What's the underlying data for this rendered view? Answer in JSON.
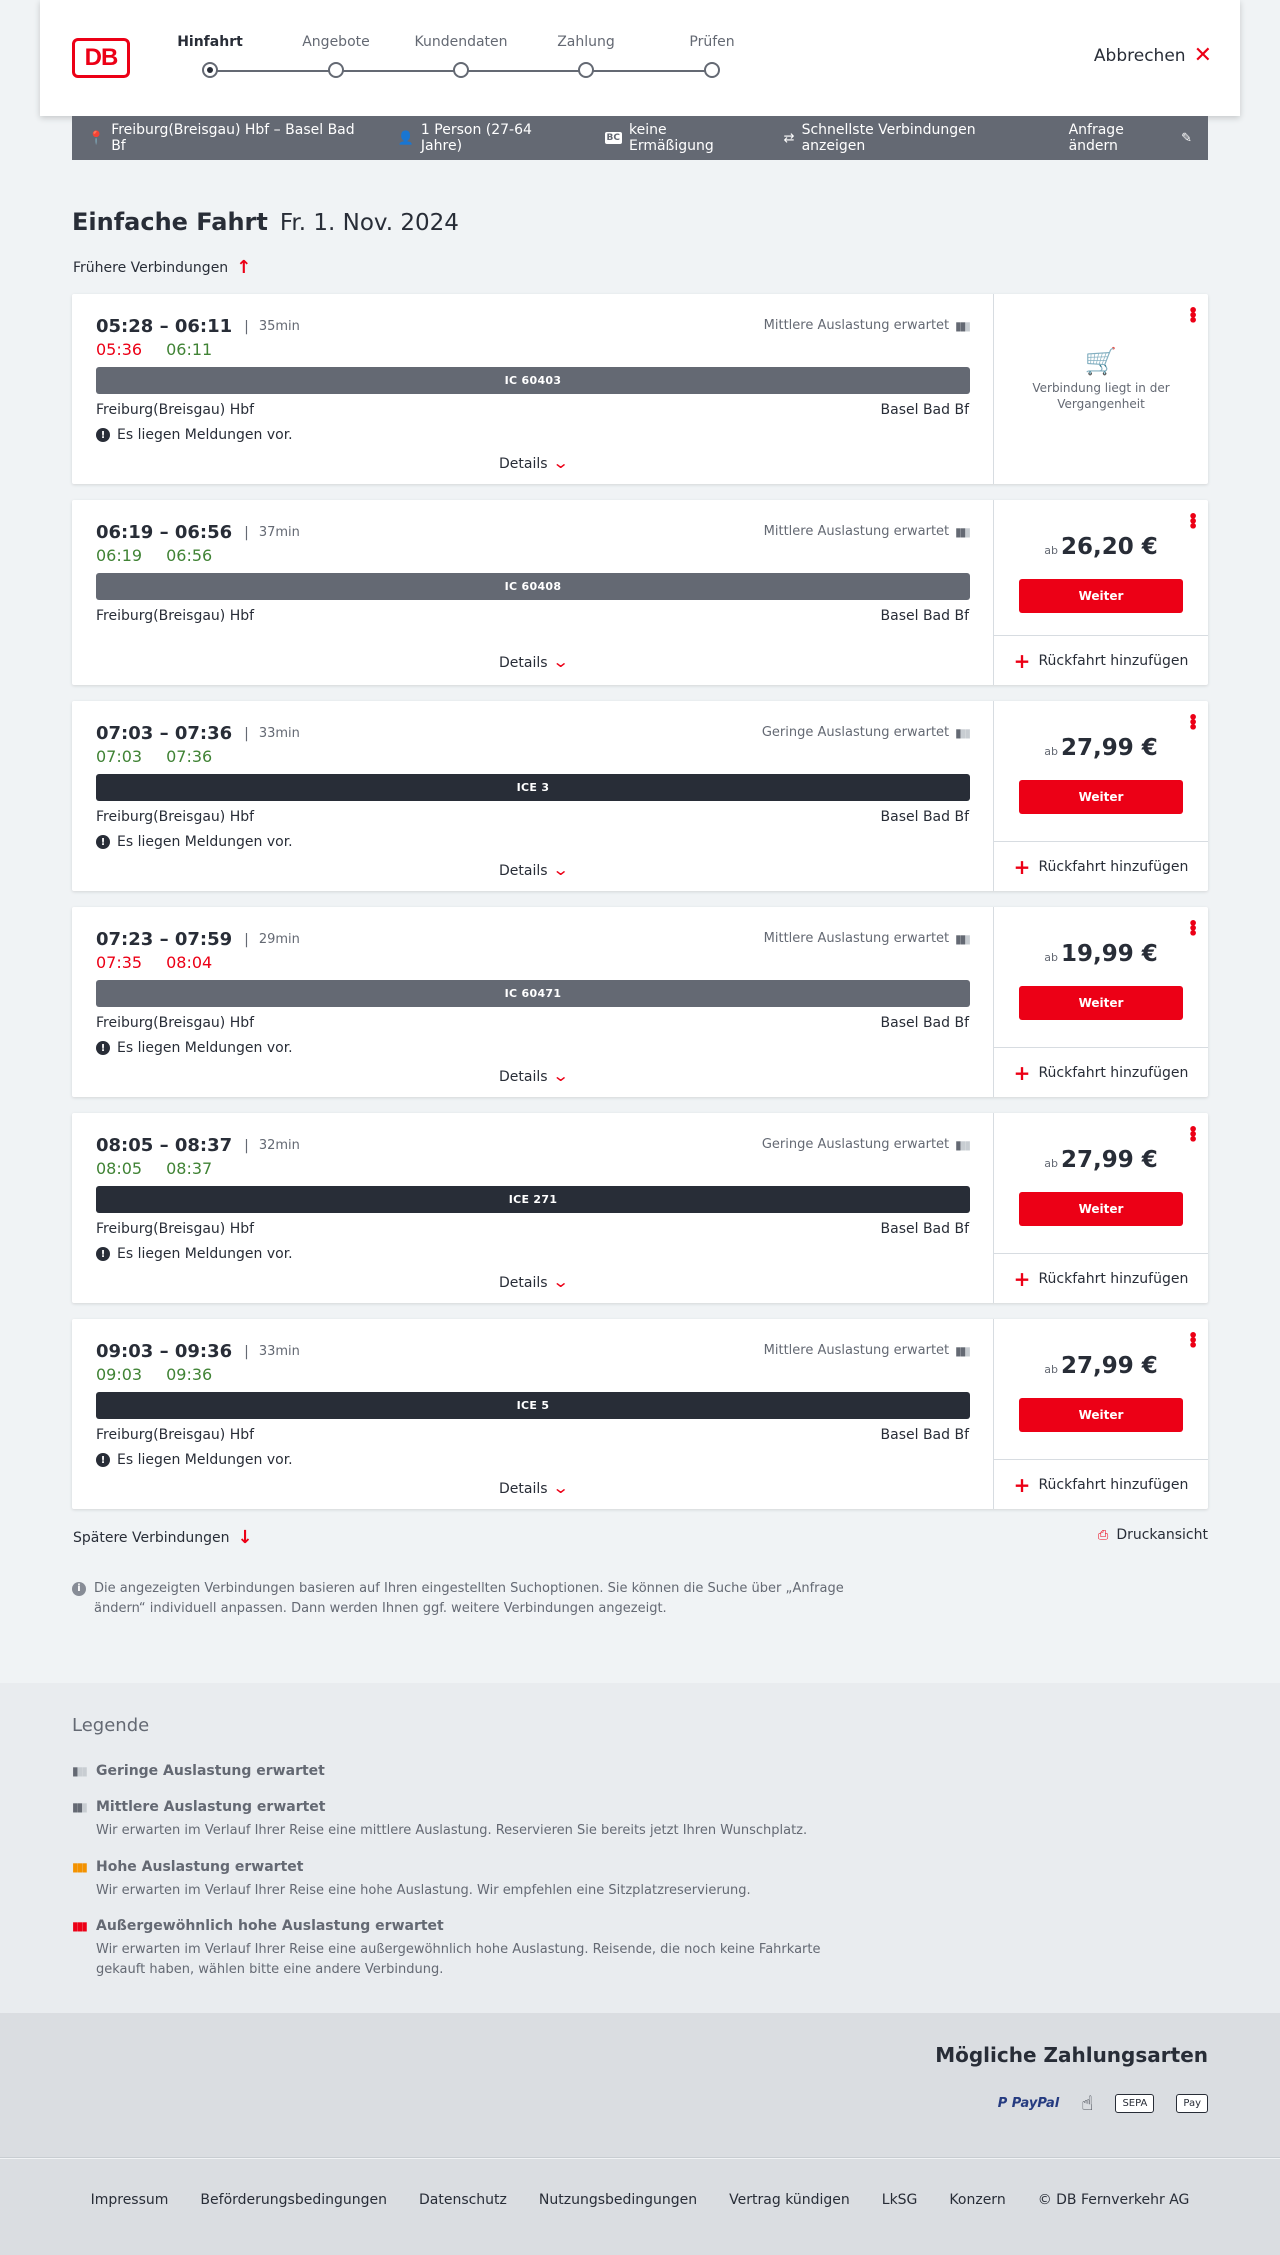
{
  "header": {
    "logo_text": "DB",
    "steps": [
      {
        "label": "Hinfahrt",
        "active": true
      },
      {
        "label": "Angebote",
        "active": false
      },
      {
        "label": "Kundendaten",
        "active": false
      },
      {
        "label": "Zahlung",
        "active": false
      },
      {
        "label": "Prüfen",
        "active": false
      }
    ],
    "cancel_label": "Abbrechen"
  },
  "request": {
    "route": "Freiburg(Breisgau) Hbf – Basel Bad Bf",
    "persons": "1 Person (27-64 Jahre)",
    "bc_badge": "BC",
    "discount": "keine Ermäßigung",
    "fastest": "Schnellste Verbindungen anzeigen",
    "change": "Anfrage ändern"
  },
  "page": {
    "title": "Einfache Fahrt",
    "date": "Fr. 1. Nov. 2024",
    "earlier": "Frühere Verbindungen",
    "later": "Spätere Verbindungen",
    "print": "Druckansicht",
    "info": "Die angezeigten Verbindungen basieren auf Ihren eingestellten Suchoptionen. Sie können die Suche über „Anfrage ändern“ individuell anpassen. Dann werden Ihnen ggf. weitere Verbindungen angezeigt."
  },
  "common": {
    "from": "Freiburg(Breisgau) Hbf",
    "to": "Basel Bad Bf",
    "details": "Details",
    "message": "Es liegen Meldungen vor.",
    "weiter": "Weiter",
    "ab": "ab",
    "rueckfahrt": "Rückfahrt hinzufügen",
    "past_text": "Verbindung liegt in der Vergangenheit"
  },
  "connections": [
    {
      "times": "05:28 – 06:11",
      "duration": "35min",
      "rt_dep": "05:36",
      "rt_arr": "06:11",
      "rt_dep_status": "late",
      "rt_arr_status": "ok",
      "occupancy": "Mittlere Auslastung erwartet",
      "occ_level": 2,
      "train": "IC 60403",
      "train_type": "ic",
      "message": true,
      "past": true,
      "price": ""
    },
    {
      "times": "06:19 – 06:56",
      "duration": "37min",
      "rt_dep": "06:19",
      "rt_arr": "06:56",
      "rt_dep_status": "ok",
      "rt_arr_status": "ok",
      "occupancy": "Mittlere Auslastung erwartet",
      "occ_level": 2,
      "train": "IC 60408",
      "train_type": "ic",
      "message": false,
      "past": false,
      "price": "26,20 €"
    },
    {
      "times": "07:03 – 07:36",
      "duration": "33min",
      "rt_dep": "07:03",
      "rt_arr": "07:36",
      "rt_dep_status": "ok",
      "rt_arr_status": "ok",
      "occupancy": "Geringe Auslastung erwartet",
      "occ_level": 1,
      "train": "ICE 3",
      "train_type": "ice",
      "message": true,
      "past": false,
      "price": "27,99 €"
    },
    {
      "times": "07:23 – 07:59",
      "duration": "29min",
      "rt_dep": "07:35",
      "rt_arr": "08:04",
      "rt_dep_status": "late",
      "rt_arr_status": "late",
      "occupancy": "Mittlere Auslastung erwartet",
      "occ_level": 2,
      "train": "IC 60471",
      "train_type": "ic",
      "message": true,
      "past": false,
      "price": "19,99 €"
    },
    {
      "times": "08:05 – 08:37",
      "duration": "32min",
      "rt_dep": "08:05",
      "rt_arr": "08:37",
      "rt_dep_status": "ok",
      "rt_arr_status": "ok",
      "occupancy": "Geringe Auslastung erwartet",
      "occ_level": 1,
      "train": "ICE 271",
      "train_type": "ice",
      "message": true,
      "past": false,
      "price": "27,99 €"
    },
    {
      "times": "09:03 – 09:36",
      "duration": "33min",
      "rt_dep": "09:03",
      "rt_arr": "09:36",
      "rt_dep_status": "ok",
      "rt_arr_status": "ok",
      "occupancy": "Mittlere Auslastung erwartet",
      "occ_level": 2,
      "train": "ICE 5",
      "train_type": "ice",
      "message": true,
      "past": false,
      "price": "27,99 €"
    }
  ],
  "legend": {
    "title": "Legende",
    "items": [
      {
        "title": "Geringe Auslastung erwartet",
        "desc": "",
        "color": "#646973",
        "level": 1
      },
      {
        "title": "Mittlere Auslastung erwartet",
        "desc": "Wir erwarten im Verlauf Ihrer Reise eine mittlere Auslastung. Reservieren Sie bereits jetzt Ihren Wunschplatz.",
        "color": "#646973",
        "level": 2
      },
      {
        "title": "Hohe Auslastung erwartet",
        "desc": "Wir erwarten im Verlauf Ihrer Reise eine hohe Auslastung. Wir empfehlen eine Sitzplatzreservierung.",
        "color": "#f39200",
        "level": 3
      },
      {
        "title": "Außergewöhnlich hohe Auslastung erwartet",
        "desc": "Wir erwarten im Verlauf Ihrer Reise eine außergewöhnlich hohe Auslastung. Reisende, die noch keine Fahrkarte gekauft haben, wählen bitte eine andere Verbindung.",
        "color": "#ec0016",
        "level": 4
      }
    ]
  },
  "payment": {
    "title": "Mögliche Zahlungsarten",
    "methods": [
      "PayPal",
      "Kreditkarte",
      "SEPA",
      "Apple Pay"
    ],
    "paypal_label": "P PayPal",
    "applepay_label": " Pay",
    "sepa_label": "SEPA"
  },
  "footer": {
    "links": [
      "Impressum",
      "Beförderungsbedingungen",
      "Datenschutz",
      "Nutzungsbedingungen",
      "Vertrag kündigen",
      "LkSG",
      "Konzern",
      "© DB Fernverkehr AG"
    ]
  }
}
